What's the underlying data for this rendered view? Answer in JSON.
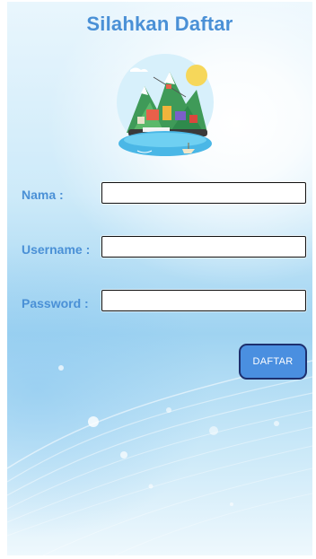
{
  "page": {
    "title": "Silahkan Daftar"
  },
  "form": {
    "nama_label": "Nama :",
    "nama_value": "",
    "username_label": "Username :",
    "username_value": "",
    "password_label": "Password :",
    "password_value": "",
    "submit_label": "DAFTAR"
  },
  "colors": {
    "title": "#4a90d6",
    "label": "#4a90d6",
    "button_bg": "#4a8fe0",
    "button_border": "#1d2f6e"
  },
  "images": {
    "illustration": "island-travel-illustration"
  }
}
